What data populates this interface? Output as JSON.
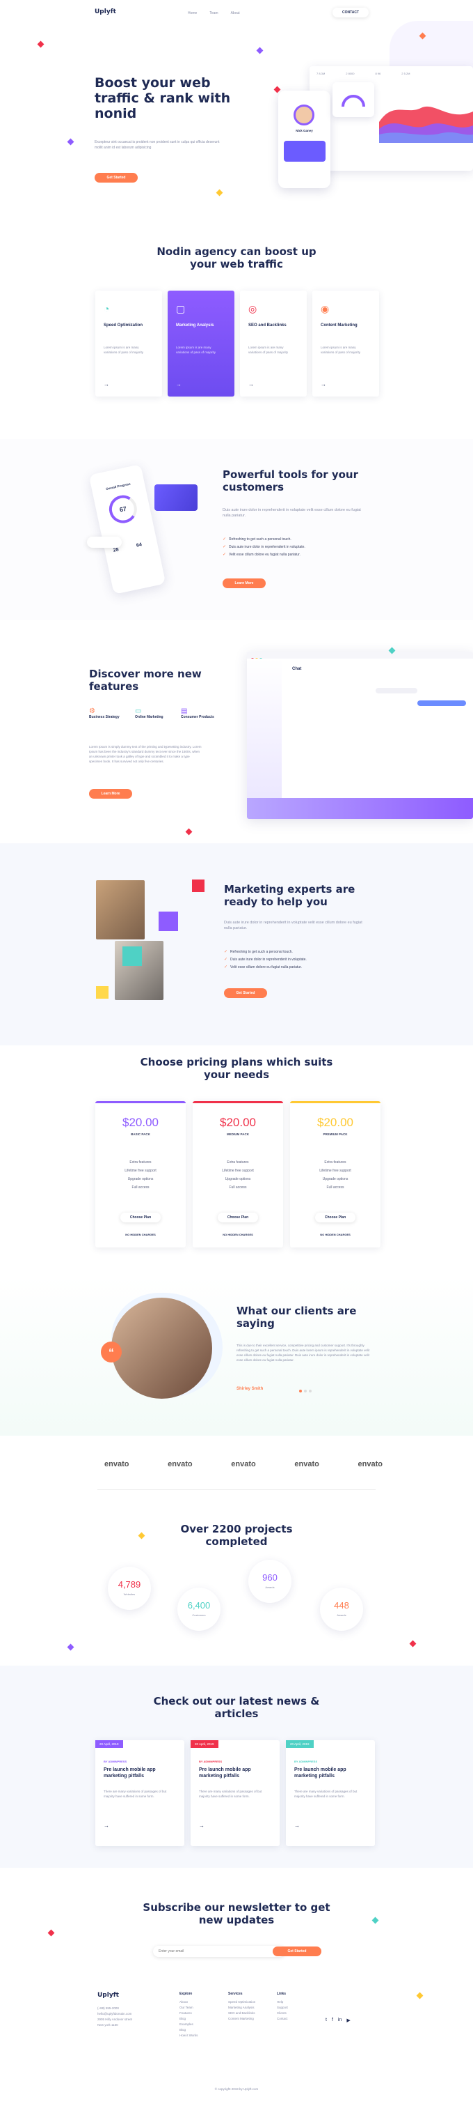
{
  "nav": {
    "logo": "Uplyft",
    "links": [
      "Home",
      "Team",
      "About"
    ],
    "contact": "CONTACT"
  },
  "hero": {
    "title": "Boost your web traffic & rank with nonid",
    "desc": "Excepteur sint occaecat is proident non proident sunt in culpa qui officia deserunt mollit anim id est laborum adipisicing",
    "cta": "Get Started",
    "mock": {
      "user": "Nick Ganey",
      "stats": [
        "7 8.3M",
        "2 8000",
        "8 96",
        "2 5.2M"
      ]
    }
  },
  "services": {
    "title": "Nodin agency can boost up your web traffic",
    "cards": [
      {
        "title": "Speed Optimization",
        "text": "Lorem ipsum is are many variations of pass of majority"
      },
      {
        "title": "Marketing Analysis",
        "text": "Lorem ipsum is are many variations of pass of majority"
      },
      {
        "title": "SEO and Backlinks",
        "text": "Lorem ipsum is are many variations of pass of majority"
      },
      {
        "title": "Content Marketing",
        "text": "Lorem ipsum is are many variations of pass of majority"
      }
    ]
  },
  "tools": {
    "title": "Powerful tools for your customers",
    "desc": "Duis aute irure dolor in reprehenderit in voluptate velit esse cillum dolore eu fugiat nulla pariatur.",
    "items": [
      "Refreshing to get such a personal touch.",
      "Duis aute irure dolor in reprehenderit in voluptate.",
      "Velit esse cillum dolore eu fugiat nulla pariatur."
    ],
    "cta": "Learn More",
    "mock": {
      "label": "Overall Progress",
      "value": "67",
      "num1": "28",
      "num2": "64"
    }
  },
  "discover": {
    "title": "Discover more new features",
    "features": [
      "Business Strategy",
      "Online Marketing",
      "Consumer Products"
    ],
    "desc": "Lorem Ipsum is simply dummy text of the printing and typesetting industry. Lorem Ipsum has been the industry's standard dummy text ever since the 1500s, when an unknown printer took a galley of type and scrambled it to make a type specimen book. It has survived not only five centuries.",
    "cta": "Learn More",
    "chat": {
      "title": "Chat"
    }
  },
  "experts": {
    "title": "Marketing experts are ready to help you",
    "desc": "Duis aute irure dolor in reprehenderit in voluptate velit esse cillum dolore eu fugiat nulla pariatur.",
    "items": [
      "Refreshing to get such a personal touch.",
      "Duis aute irure dolor in reprehenderit in voluptate.",
      "Velit esse cillum dolore eu fugiat nulla pariatur."
    ],
    "cta": "Get Started"
  },
  "pricing": {
    "title": "Choose pricing plans which suits your needs",
    "plans": [
      {
        "price": "$20.00",
        "name": "BASIC PACK",
        "features": [
          "Extra features",
          "Lifetime free support",
          "Upgrade options",
          "Full access"
        ],
        "cta": "Choose Plan",
        "note": "NO HIDDEN CHARGES",
        "color": "#8e5cff"
      },
      {
        "price": "$20.00",
        "name": "MEDIUM PACK",
        "features": [
          "Extra features",
          "Lifetime free support",
          "Upgrade options",
          "Full access"
        ],
        "cta": "Choose Plan",
        "note": "NO HIDDEN CHARGES",
        "color": "#f0314a"
      },
      {
        "price": "$20.00",
        "name": "PREMIUM PACK",
        "features": [
          "Extra features",
          "Lifetime free support",
          "Upgrade options",
          "Full access"
        ],
        "cta": "Choose Plan",
        "note": "NO HIDDEN CHARGES",
        "color": "#ffc933"
      }
    ]
  },
  "testimonial": {
    "title": "What our clients are saying",
    "quote": "This is due to their excellent service, competitive pricing and customer support. It's throughly refreshing to get such a personal touch. Duis aute lorem ipsum is reprehenderit in voluptate velit esse cillum dolore eu fugiat nulla pariatur. Duis aute irure dolor in reprehenderit in voluptate velit esse cillum dolore eu fugiat nulla pariatur.",
    "name": "Shirley Smith"
  },
  "brands": [
    "envato",
    "envato",
    "envato",
    "envato",
    "envato"
  ],
  "projects": {
    "title": "Over 2200 projects completed",
    "stats": [
      {
        "value": "4,789",
        "label": "Websites",
        "color": "#f0314a"
      },
      {
        "value": "6,400",
        "label": "Customers",
        "color": "#4fd1c5"
      },
      {
        "value": "960",
        "label": "Awards",
        "color": "#8e5cff"
      },
      {
        "value": "448",
        "label": "Awards",
        "color": "#ff7d4f"
      }
    ]
  },
  "news": {
    "title": "Check out our latest news & articles",
    "posts": [
      {
        "date": "20 April, 2019",
        "cat": "BY ADMINPRESS",
        "title": "Pre launch mobile app marketing pitfalls",
        "text": "There are many variations of passages of but majority have suffered in some form.",
        "color": "#8e5cff"
      },
      {
        "date": "20 April, 2019",
        "cat": "BY ADMINPRESS",
        "title": "Pre launch mobile app marketing pitfalls",
        "text": "There are many variations of passages of but majority have suffered in some form.",
        "color": "#f0314a"
      },
      {
        "date": "20 April, 2019",
        "cat": "BY ADMINPRESS",
        "title": "Pre launch mobile app marketing pitfalls",
        "text": "There are many variations of passages of but majority have suffered in some form.",
        "color": "#4fd1c5"
      }
    ]
  },
  "newsletter": {
    "title": "Subscribe our newsletter to get new updates",
    "placeholder": "Enter your email",
    "cta": "Get Started"
  },
  "footer": {
    "logo": "Uplyft",
    "contact": [
      "(+88) 555-2000",
      "hello@uplyftdomain.com",
      "2905 Hilly Andover street",
      "New york 1150"
    ],
    "cols": [
      {
        "title": "Explore",
        "items": [
          "About",
          "Our Team",
          "Features",
          "Blog",
          "Examples",
          "Blog",
          "How it Works"
        ]
      },
      {
        "title": "Services",
        "items": [
          "Speed Optimization",
          "Marketing Analysis",
          "SEO and Backlinks",
          "Content Marketing"
        ]
      },
      {
        "title": "Links",
        "items": [
          "Help",
          "Support",
          "Clients",
          "Contact"
        ]
      }
    ],
    "copyright": "© copyright 2019 by Uplyft.com"
  }
}
